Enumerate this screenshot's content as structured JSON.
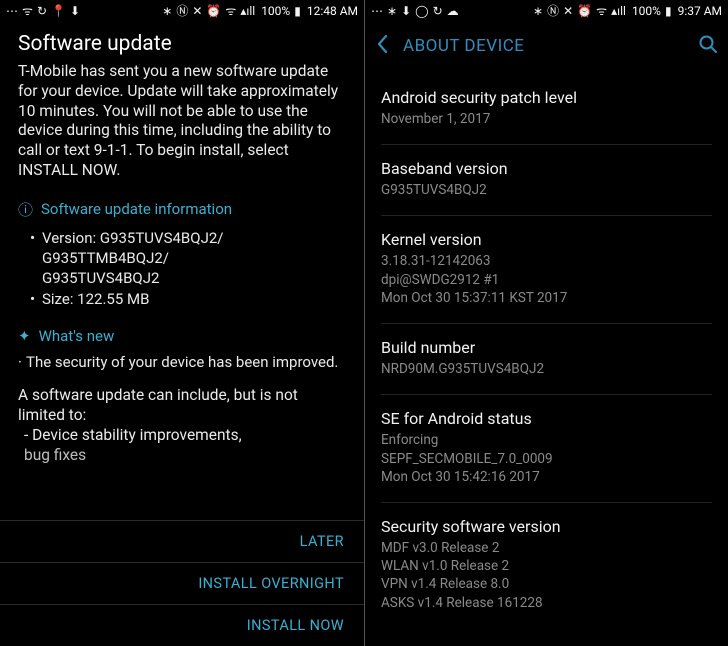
{
  "left": {
    "statusbar": {
      "battery": "100%",
      "time": "12:48 AM"
    },
    "title": "Software update",
    "intro": "T-Mobile has sent you a new software update for your device. Update will take approximately 10 minutes. You will not be able to use the device during this time, including the ability to call or text 9-1-1. To begin install, select INSTALL NOW.",
    "section_info_title": "Software update information",
    "info_version_label": "Version: G935TUVS4BQJ2/\nG935TTMB4BQJ2/\nG935TUVS4BQJ2",
    "info_size_label": "Size: 122.55 MB",
    "section_new_title": "What's new",
    "whatsnew_line": "The security of your device has been improved.",
    "scope_intro": "A software update can include, but is not limited to:",
    "scope_item1": "- Device stability improvements,",
    "scope_item2_cut": "bug fixes",
    "buttons": {
      "later": "LATER",
      "overnight": "INSTALL OVERNIGHT",
      "now": "INSTALL NOW"
    }
  },
  "right": {
    "statusbar": {
      "battery": "100%",
      "time": "9:37 AM"
    },
    "appbar_title": "ABOUT DEVICE",
    "rows": [
      {
        "label": "Android security patch level",
        "value": "November 1, 2017"
      },
      {
        "label": "Baseband version",
        "value": "G935TUVS4BQJ2"
      },
      {
        "label": "Kernel version",
        "value": "3.18.31-12142063\ndpi@SWDG2912 #1\nMon Oct 30 15:37:11 KST 2017"
      },
      {
        "label": "Build number",
        "value": "NRD90M.G935TUVS4BQJ2"
      },
      {
        "label": "SE for Android status",
        "value": "Enforcing\nSEPF_SECMOBILE_7.0_0009\nMon Oct 30 15:42:16 2017"
      },
      {
        "label": "Security software version",
        "value": "MDF v3.0 Release 2\nWLAN v1.0 Release 2\nVPN v1.4 Release 8.0\nASKS v1.4 Release 161228"
      }
    ]
  }
}
